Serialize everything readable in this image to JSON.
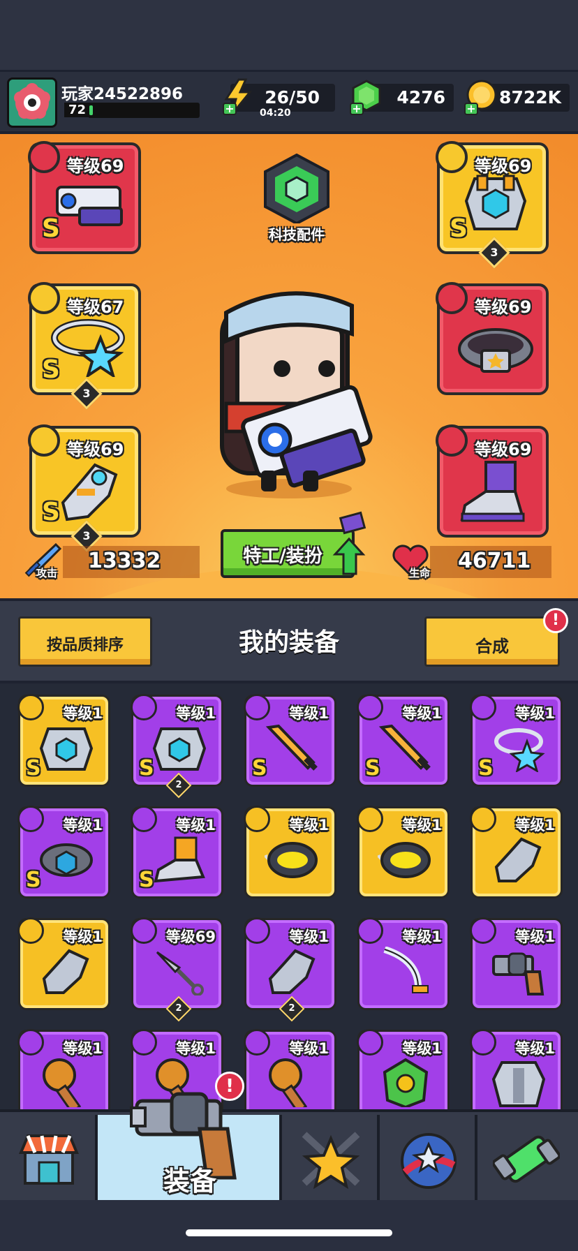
{
  "player": {
    "name": "玩家24522896",
    "level": "72",
    "xp_progress": 0.03
  },
  "resources": {
    "energy": {
      "value": "26/50",
      "timer": "04:20"
    },
    "gems": {
      "value": "4276"
    },
    "coins": {
      "value": "8722K"
    }
  },
  "tech_parts": {
    "label": "科技配件"
  },
  "equipped": {
    "weapon": {
      "level": "等级69",
      "grade": "S",
      "color": "red"
    },
    "armor": {
      "level": "等级69",
      "grade": "S",
      "count": "3",
      "color": "yellow"
    },
    "necklace": {
      "level": "等级67",
      "grade": "S",
      "count": "3",
      "color": "yellow"
    },
    "belt": {
      "level": "等级69",
      "grade": "",
      "color": "red"
    },
    "gloves": {
      "level": "等级69",
      "grade": "S",
      "count": "3",
      "color": "yellow"
    },
    "boots": {
      "level": "等级69",
      "grade": "",
      "color": "red"
    }
  },
  "stats": {
    "attack": {
      "label": "攻击",
      "value": "13332"
    },
    "hp": {
      "label": "生命",
      "value": "46711"
    }
  },
  "agent_button": {
    "label": "特工/装扮"
  },
  "toolbar": {
    "sort_label": "按品质排序",
    "title": "我的装备",
    "merge_label": "合成",
    "merge_alert": "!"
  },
  "inventory": [
    {
      "level": "等级1",
      "grade": "S",
      "count": "",
      "rarity": "yellow",
      "type": "armor"
    },
    {
      "level": "等级1",
      "grade": "S",
      "count": "2",
      "rarity": "purple",
      "type": "armor"
    },
    {
      "level": "等级1",
      "grade": "S",
      "count": "",
      "rarity": "purple",
      "type": "sword"
    },
    {
      "level": "等级1",
      "grade": "S",
      "count": "",
      "rarity": "purple",
      "type": "sword"
    },
    {
      "level": "等级1",
      "grade": "S",
      "count": "",
      "rarity": "purple",
      "type": "necklace"
    },
    {
      "level": "等级1",
      "grade": "S",
      "count": "",
      "rarity": "purple",
      "type": "belt"
    },
    {
      "level": "等级1",
      "grade": "S",
      "count": "",
      "rarity": "purple",
      "type": "boots"
    },
    {
      "level": "等级1",
      "grade": "",
      "count": "",
      "rarity": "yellow",
      "type": "spiked-collar"
    },
    {
      "level": "等级1",
      "grade": "",
      "count": "",
      "rarity": "yellow",
      "type": "spiked-collar"
    },
    {
      "level": "等级1",
      "grade": "",
      "count": "",
      "rarity": "yellow",
      "type": "gauntlet"
    },
    {
      "level": "等级1",
      "grade": "",
      "count": "",
      "rarity": "yellow",
      "type": "gauntlet"
    },
    {
      "level": "等级69",
      "grade": "",
      "count": "2",
      "rarity": "purple",
      "type": "kunai"
    },
    {
      "level": "等级1",
      "grade": "",
      "count": "2",
      "rarity": "purple",
      "type": "gauntlet"
    },
    {
      "level": "等级1",
      "grade": "",
      "count": "",
      "rarity": "purple",
      "type": "saber"
    },
    {
      "level": "等级1",
      "grade": "",
      "count": "",
      "rarity": "purple",
      "type": "revolver"
    },
    {
      "level": "等级1",
      "grade": "",
      "count": "",
      "rarity": "purple",
      "type": "torch"
    },
    {
      "level": "等级1",
      "grade": "",
      "count": "",
      "rarity": "purple",
      "type": "torch"
    },
    {
      "level": "等级1",
      "grade": "",
      "count": "",
      "rarity": "purple",
      "type": "torch"
    },
    {
      "level": "等级1",
      "grade": "",
      "count": "",
      "rarity": "purple",
      "type": "leaf-armor"
    },
    {
      "level": "等级1",
      "grade": "",
      "count": "",
      "rarity": "purple",
      "type": "steel-armor"
    }
  ],
  "bottom_nav": {
    "tabs": [
      {
        "name": "shop",
        "label": ""
      },
      {
        "name": "equipment",
        "label": "装备",
        "active": true,
        "alert": "!"
      },
      {
        "name": "battle",
        "label": ""
      },
      {
        "name": "talents",
        "label": ""
      },
      {
        "name": "lab",
        "label": ""
      }
    ]
  },
  "colors": {
    "hero_bg": "#f28b2b",
    "purple": "#a23fe8",
    "yellow": "#f6c024",
    "red": "#e0364b",
    "nav_active": "#bde4f7"
  }
}
